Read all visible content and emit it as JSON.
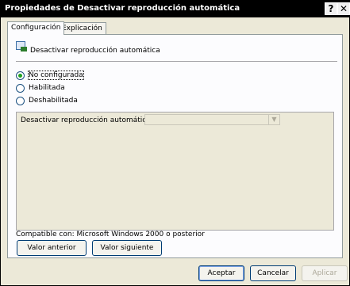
{
  "window": {
    "title": "Propiedades de Desactivar reproducción automática"
  },
  "titlebar": {
    "help_glyph": "?",
    "close_glyph": "✕"
  },
  "tabs": [
    {
      "label": "Configuración",
      "active": true
    },
    {
      "label": "Explicación",
      "active": false
    }
  ],
  "policy": {
    "name": "Desactivar reproducción automática",
    "icon": "policy-setting-icon"
  },
  "radios": [
    {
      "label": "No configurada",
      "checked": true
    },
    {
      "label": "Habilitada",
      "checked": false
    },
    {
      "label": "Deshabilitada",
      "checked": false
    }
  ],
  "options": {
    "label": "Desactivar reproducción automática en:",
    "value": ""
  },
  "compat": "Compatible con: Microsoft Windows 2000 o posterior",
  "nav": {
    "prev_label": "Valor anterior",
    "next_label": "Valor siguiente"
  },
  "footer": {
    "ok_label": "Aceptar",
    "cancel_label": "Cancelar",
    "apply_label": "Aplicar"
  }
}
